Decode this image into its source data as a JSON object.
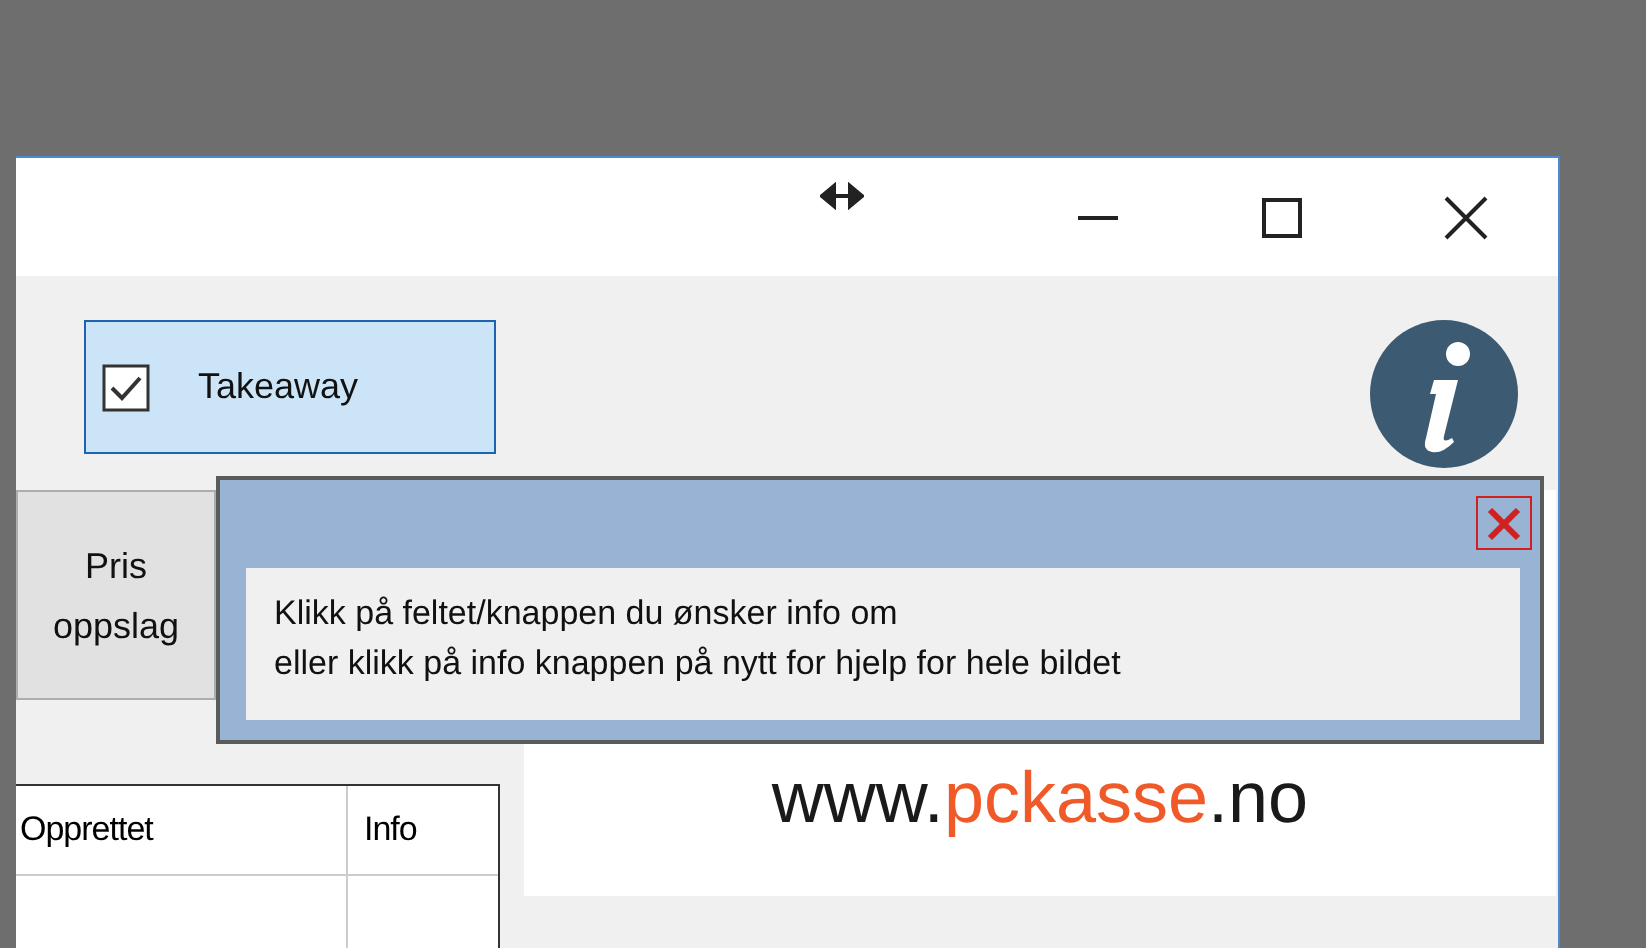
{
  "takeaway": {
    "label": "Takeaway",
    "checked": true
  },
  "price_button": {
    "lines": [
      "Pris",
      "oppslag"
    ]
  },
  "table": {
    "columns": [
      "Opprettet",
      "Info"
    ]
  },
  "logo": {
    "prefix": "www.",
    "name": "pckasse",
    "suffix": ".no"
  },
  "info_popup": {
    "lines": [
      "Klikk på feltet/knappen du ønsker info om",
      "eller klikk på info knappen på nytt for hjelp for hele bildet"
    ]
  }
}
